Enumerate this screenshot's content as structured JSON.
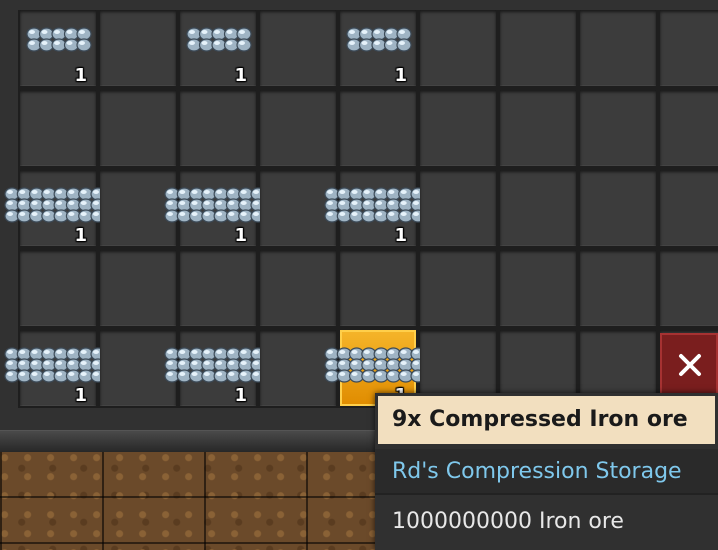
{
  "inventory": {
    "rows": [
      [
        {
          "item": "compressed-iron-ore",
          "count": "1"
        },
        {},
        {
          "item": "compressed-iron-ore",
          "count": "1"
        },
        {},
        {
          "item": "compressed-iron-ore",
          "count": "1"
        },
        {},
        {},
        {},
        {}
      ],
      [
        {},
        {},
        {},
        {},
        {},
        {},
        {},
        {},
        {}
      ],
      [
        {
          "item": "compressed-iron-ore",
          "count": "1"
        },
        {},
        {
          "item": "compressed-iron-ore",
          "count": "1"
        },
        {},
        {
          "item": "compressed-iron-ore",
          "count": "1"
        },
        {},
        {},
        {},
        {}
      ],
      [
        {},
        {},
        {},
        {},
        {},
        {},
        {},
        {},
        {}
      ],
      [
        {
          "item": "compressed-iron-ore",
          "count": "1"
        },
        {},
        {
          "item": "compressed-iron-ore",
          "count": "1"
        },
        {},
        {
          "item": "compressed-iron-ore",
          "count": "1",
          "selected": true
        },
        {},
        {},
        {},
        {}
      ]
    ]
  },
  "close_icon": "close-icon",
  "colors": {
    "selected_slot": "#f0a020",
    "close_button": "#7a1e1e",
    "tooltip_title_bg": "#f2dfbf",
    "tooltip_source_text": "#7fc8ec"
  },
  "tooltip": {
    "title": "9x Compressed Iron ore",
    "source": "Rd's Compression Storage",
    "contents": "1000000000 Iron ore"
  }
}
